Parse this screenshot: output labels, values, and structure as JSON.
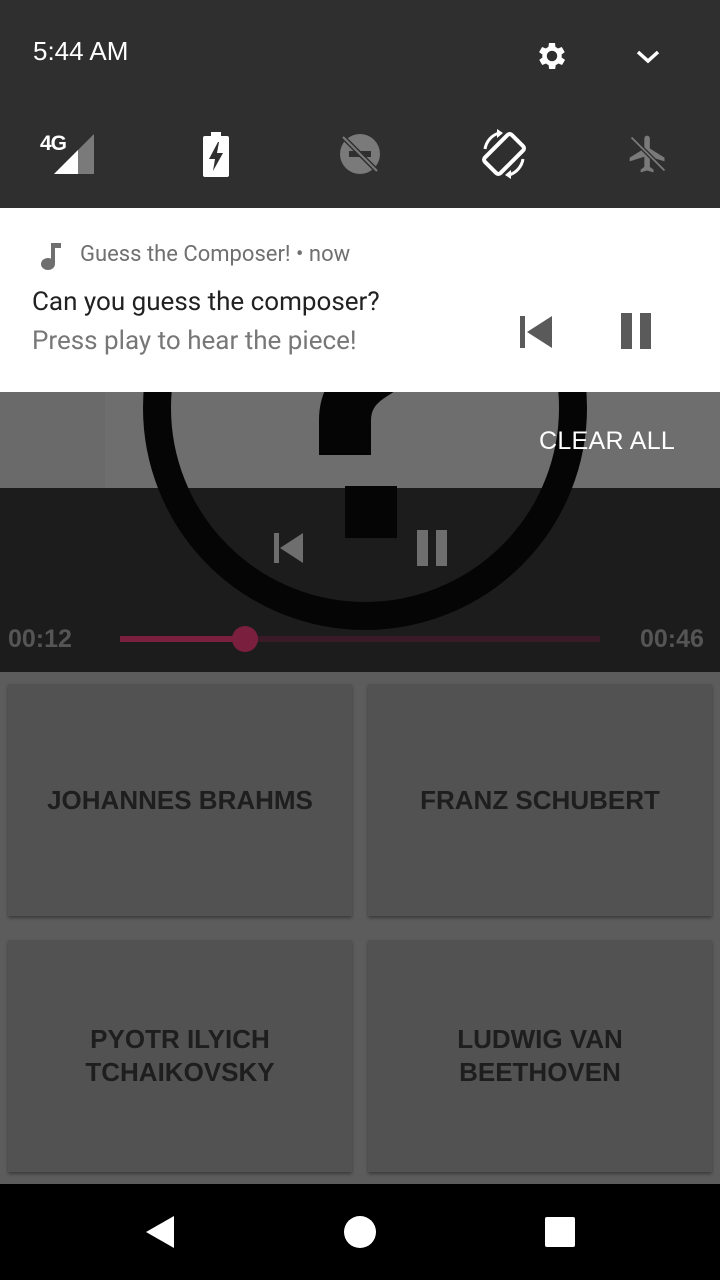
{
  "status_bar": {
    "time": "5:44 AM",
    "network_label": "4G"
  },
  "quick_settings": {
    "items": [
      {
        "name": "mobile-data",
        "icon": "signal-4g-icon"
      },
      {
        "name": "battery-saver",
        "icon": "battery-charging-icon"
      },
      {
        "name": "do-not-disturb",
        "icon": "do-not-disturb-off-icon"
      },
      {
        "name": "auto-rotate",
        "icon": "auto-rotate-icon"
      },
      {
        "name": "airplane-mode",
        "icon": "airplane-icon"
      }
    ]
  },
  "notification": {
    "app_name": "Guess the Composer! • now",
    "title": "Can you guess the composer?",
    "text": "Press play to hear the piece!",
    "actions": [
      "skip-previous-icon",
      "pause-icon"
    ]
  },
  "clear_all_label": "CLEAR ALL",
  "player": {
    "elapsed": "00:12",
    "total": "00:46",
    "progress": 0.26,
    "accent": "#7b1f3e"
  },
  "answers": [
    {
      "label": "JOHANNES BRAHMS"
    },
    {
      "label": "FRANZ SCHUBERT"
    },
    {
      "label": "PYOTR ILYICH TCHAIKOVSKY"
    },
    {
      "label": "LUDWIG VAN BEETHOVEN"
    }
  ],
  "nav_bar": [
    "back-icon",
    "home-icon",
    "recents-icon"
  ]
}
